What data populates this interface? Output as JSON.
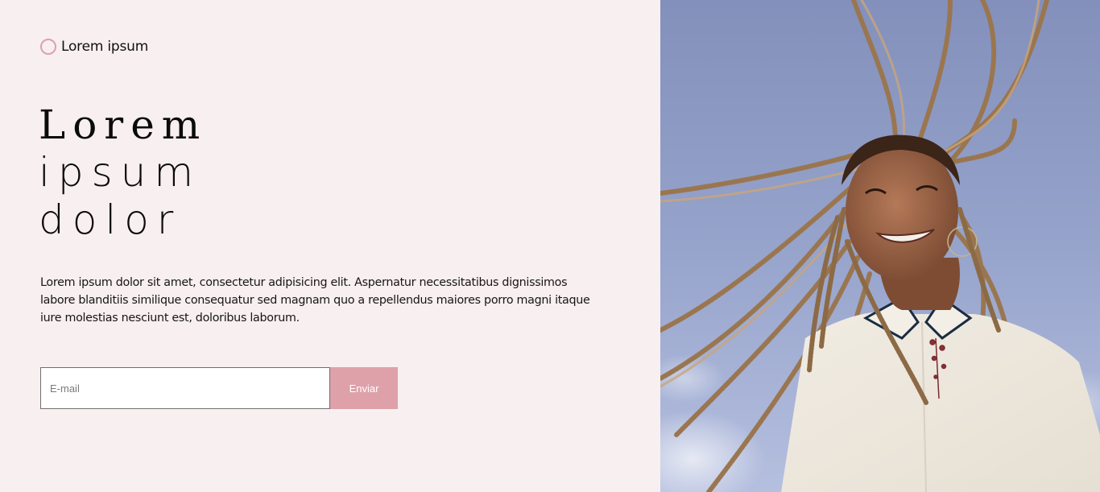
{
  "brand": {
    "name": "Lorem ipsum",
    "icon": "circle-logo-icon",
    "accent": "#dca1a9"
  },
  "hero": {
    "title_line1": "Lorem",
    "title_line2": "ipsum",
    "title_line3": "dolor",
    "description": "Lorem ipsum dolor sit amet, consectetur adipisicing elit. Aspernatur necessitatibus dignissimos labore blanditiis similique consequatur sed magnam quo a repellendus maiores porro magni itaque iure molestias nesciunt est, doloribus laborum."
  },
  "form": {
    "email_placeholder": "E-mail",
    "email_value": "",
    "submit_label": "Enviar",
    "button_color": "#dea1aa"
  },
  "colors": {
    "background": "#f8eff0",
    "sky": "#8f9cc6"
  }
}
